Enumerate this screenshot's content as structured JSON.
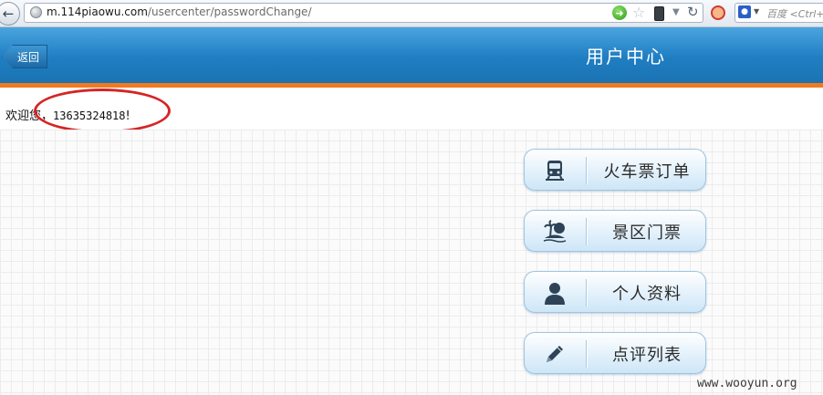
{
  "browser": {
    "url_domain": "m.114piaowu.com",
    "url_path": "/usercenter/passwordChange/",
    "search_placeholder": "百度 <Ctrl+"
  },
  "header": {
    "back_label": "返回",
    "title": "用户中心"
  },
  "greeting": {
    "prefix": "欢迎您，",
    "phone": "13635324818",
    "suffix": "!"
  },
  "menu": {
    "items": [
      {
        "label": "火车票订单",
        "icon": "train-icon"
      },
      {
        "label": "景区门票",
        "icon": "island-icon"
      },
      {
        "label": "个人资料",
        "icon": "person-icon"
      },
      {
        "label": "点评列表",
        "icon": "pencil-icon"
      }
    ]
  },
  "watermark": "www.wooyun.org",
  "colors": {
    "header_blue": "#1f7ec2",
    "accent_orange": "#f07a1f",
    "highlight_red": "#d62424"
  }
}
